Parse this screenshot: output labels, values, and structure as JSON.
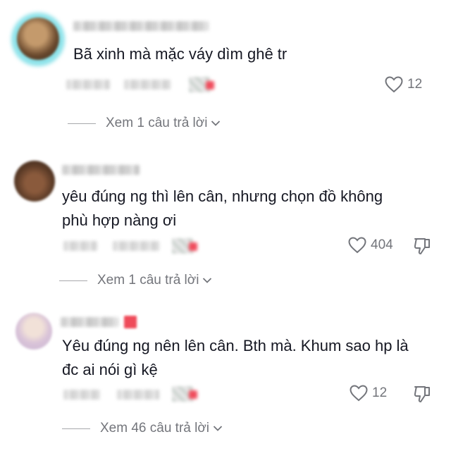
{
  "comments": [
    {
      "text_lines": [
        "Bã xinh mà mặc váy dìm ghê tr"
      ],
      "like_count": "12",
      "view_replies_label": "Xem 1 câu trả lời",
      "icons": [
        "heart-icon"
      ]
    },
    {
      "text_lines": [
        "yêu đúng ng thì lên cân, nhưng chọn đồ không",
        "phù hợp nàng ơi"
      ],
      "like_count": "404",
      "view_replies_label": "Xem 1 câu trả lời",
      "icons": [
        "heart-icon",
        "thumbs-down-icon"
      ]
    },
    {
      "text_lines": [
        "Yêu đúng ng nên lên cân. Bth mà. Khum sao hp là",
        "đc ai nói gì kệ"
      ],
      "like_count": "12",
      "view_replies_label": "Xem 46 câu trả lời",
      "icons": [
        "heart-icon",
        "thumbs-down-icon"
      ]
    }
  ],
  "colors": {
    "text": "#161823",
    "muted": "#73757b",
    "background": "#ffffff",
    "blurred_accent": "#ef4b5a"
  }
}
